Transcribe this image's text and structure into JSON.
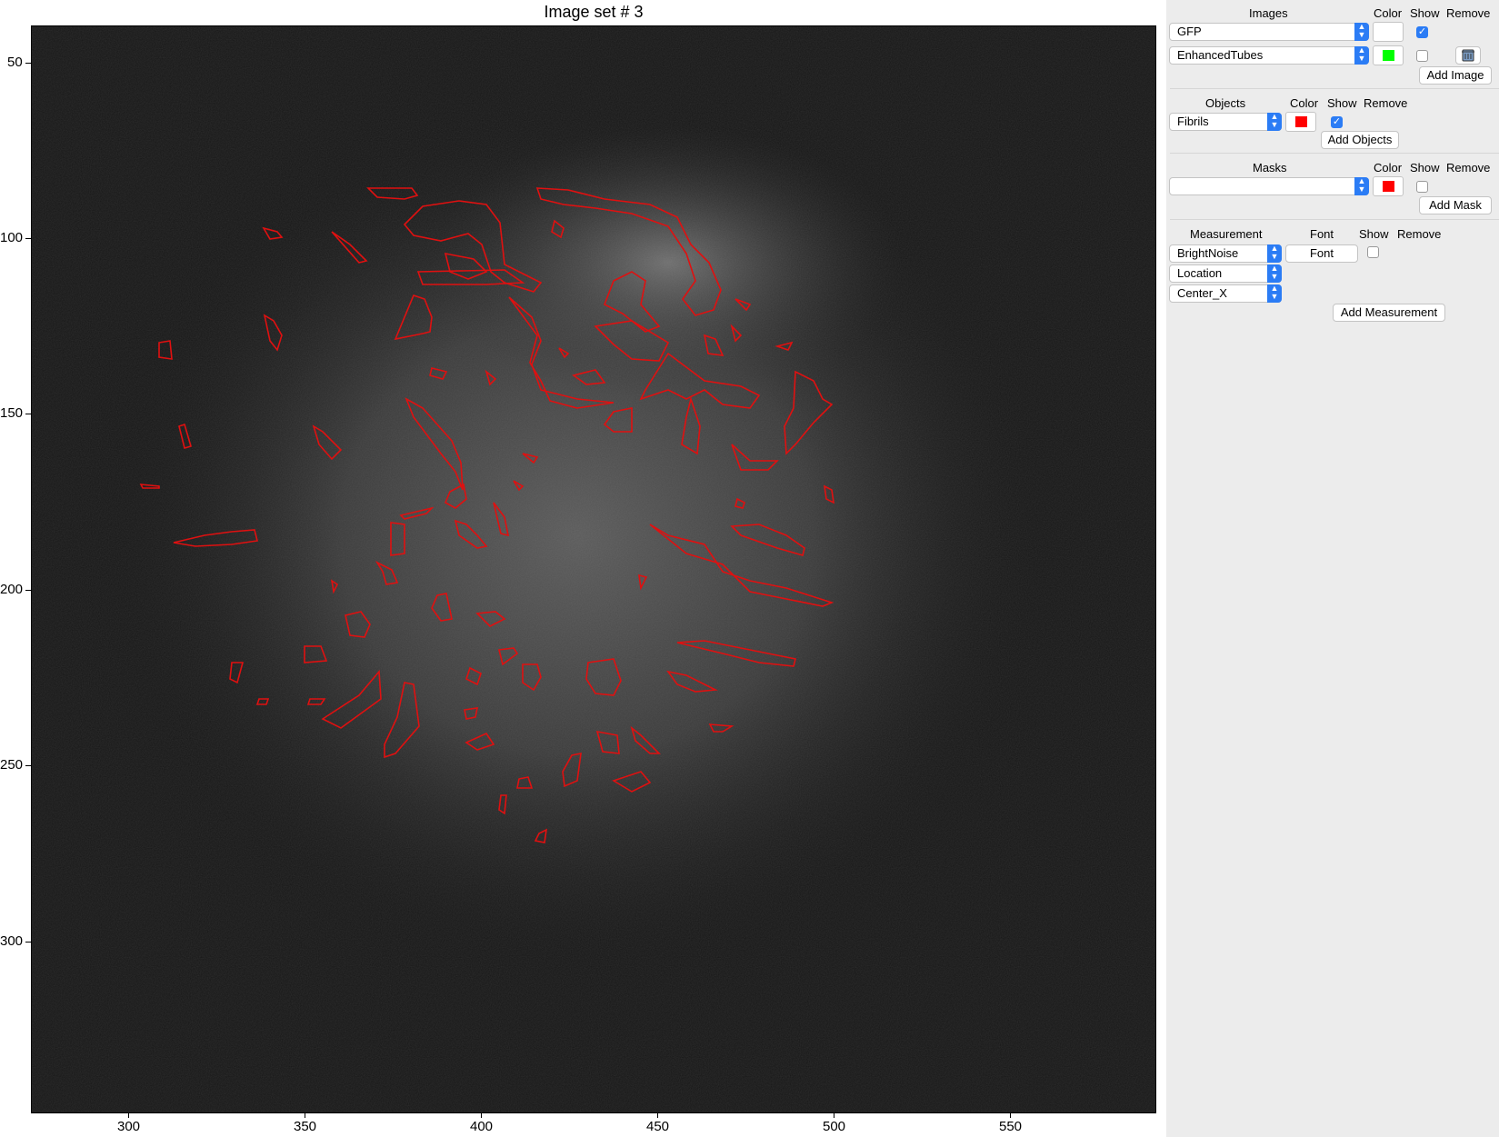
{
  "figure": {
    "title": "Image set # 3",
    "x_ticks": [
      "300",
      "350",
      "400",
      "450",
      "500",
      "550"
    ],
    "y_ticks": [
      "50",
      "100",
      "150",
      "200",
      "250",
      "300"
    ]
  },
  "images": {
    "header": "Images",
    "col_color": "Color",
    "col_show": "Show",
    "col_remove": "Remove",
    "rows": [
      {
        "name": "GFP",
        "color": "#ffffff",
        "show": true
      },
      {
        "name": "EnhancedTubes",
        "color": "#00ff00",
        "show": false
      }
    ],
    "add_label": "Add Image"
  },
  "objects": {
    "header": "Objects",
    "col_color": "Color",
    "col_show": "Show",
    "col_remove": "Remove",
    "rows": [
      {
        "name": "Fibrils",
        "color": "#ff0000",
        "show": true
      }
    ],
    "add_label": "Add Objects"
  },
  "masks": {
    "header": "Masks",
    "col_color": "Color",
    "col_show": "Show",
    "col_remove": "Remove",
    "rows": [
      {
        "name": "",
        "color": "#ff0000",
        "show": false
      }
    ],
    "add_label": "Add Mask"
  },
  "measurement": {
    "header": "Measurement",
    "col_font": "Font",
    "col_show": "Show",
    "col_remove": "Remove",
    "selects": [
      "BrightNoise",
      "Location",
      "Center_X"
    ],
    "font_button": "Font",
    "show": false,
    "add_label": "Add Measurement"
  },
  "icons": {
    "remove": "trash-icon",
    "dropdown": "chevron-updown-icon",
    "check": "checkmark-icon"
  }
}
